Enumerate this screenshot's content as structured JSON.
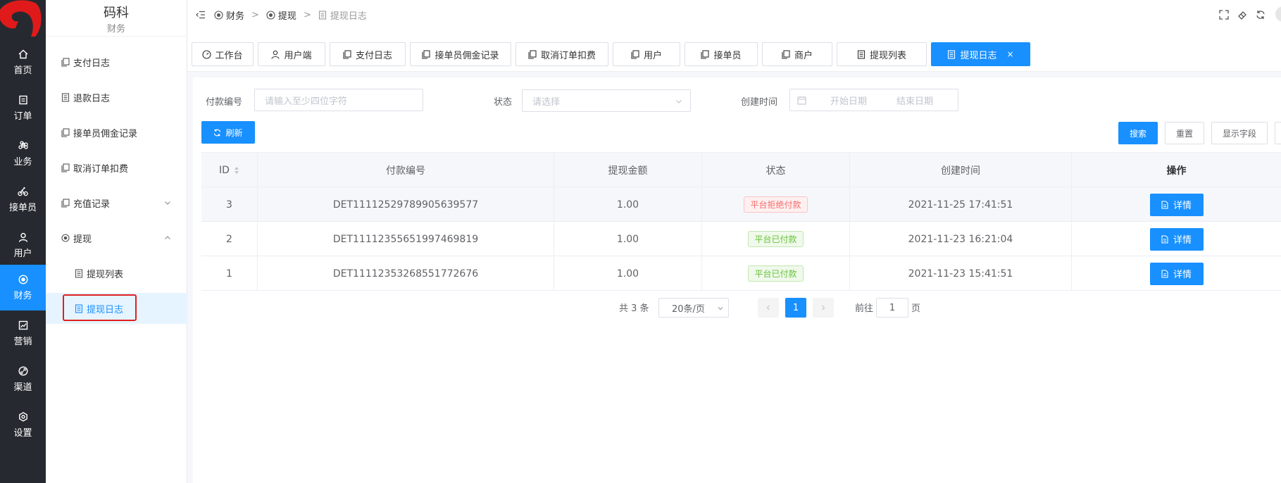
{
  "app": {
    "title": "码科",
    "section": "财务"
  },
  "rail": {
    "items": [
      {
        "label": "首页",
        "icon": "home-icon"
      },
      {
        "label": "订单",
        "icon": "order-icon"
      },
      {
        "label": "业务",
        "icon": "command-icon"
      },
      {
        "label": "接单员",
        "icon": "bike-icon"
      },
      {
        "label": "用户",
        "icon": "user-icon"
      },
      {
        "label": "财务",
        "icon": "finance-icon"
      },
      {
        "label": "营销",
        "icon": "chart-icon"
      },
      {
        "label": "渠道",
        "icon": "link-icon"
      },
      {
        "label": "设置",
        "icon": "gear-icon"
      }
    ]
  },
  "submenu": {
    "items": [
      {
        "label": "支付日志"
      },
      {
        "label": "退款日志"
      },
      {
        "label": "接单员佣金记录"
      },
      {
        "label": "取消订单扣费"
      },
      {
        "label": "充值记录"
      },
      {
        "label": "提现"
      },
      {
        "label": "提现列表"
      },
      {
        "label": "提现日志"
      }
    ]
  },
  "breadcrumb": {
    "items": [
      "财务",
      "提现",
      "提现日志"
    ],
    "separator": ">"
  },
  "tabs": [
    {
      "label": "工作台"
    },
    {
      "label": "用户端"
    },
    {
      "label": "支付日志"
    },
    {
      "label": "接单员佣金记录"
    },
    {
      "label": "取消订单扣费"
    },
    {
      "label": "用户"
    },
    {
      "label": "接单员"
    },
    {
      "label": "商户"
    },
    {
      "label": "提现列表"
    },
    {
      "label": "提现日志",
      "close": "×"
    }
  ],
  "filters": {
    "payment_no_label": "付款编号",
    "payment_no_placeholder": "请输入至少四位字符",
    "status_label": "状态",
    "status_placeholder": "请选择",
    "created_label": "创建时间",
    "start_placeholder": "开始日期",
    "end_placeholder": "结束日期"
  },
  "buttons": {
    "refresh": "刷新",
    "search": "搜索",
    "reset": "重置",
    "columns": "显示字段"
  },
  "table": {
    "headers": [
      "ID",
      "付款编号",
      "提现金额",
      "状态",
      "创建时间",
      "操作"
    ],
    "rows": [
      {
        "id": "3",
        "payment_no": "DET11112529789905639577",
        "amount": "1.00",
        "status": "平台拒绝付款",
        "created": "2021-11-25 17:41:51",
        "action": "详情"
      },
      {
        "id": "2",
        "payment_no": "DET11112355651997469819",
        "amount": "1.00",
        "status": "平台已付款",
        "created": "2021-11-23 16:21:04",
        "action": "详情"
      },
      {
        "id": "1",
        "payment_no": "DET11112353268551772676",
        "amount": "1.00",
        "status": "平台已付款",
        "created": "2021-11-23 15:41:51",
        "action": "详情"
      }
    ]
  },
  "pagination": {
    "total_text": "共 3 条",
    "page_size": "20条/页",
    "current_page": "1",
    "goto_label": "前往",
    "goto_value": "1",
    "page_suffix": "页"
  },
  "colors": {
    "primary": "#1890ff",
    "sidebar": "#262a30",
    "danger": "#f56c6c",
    "success": "#67c23a",
    "highlight": "#e02020"
  }
}
